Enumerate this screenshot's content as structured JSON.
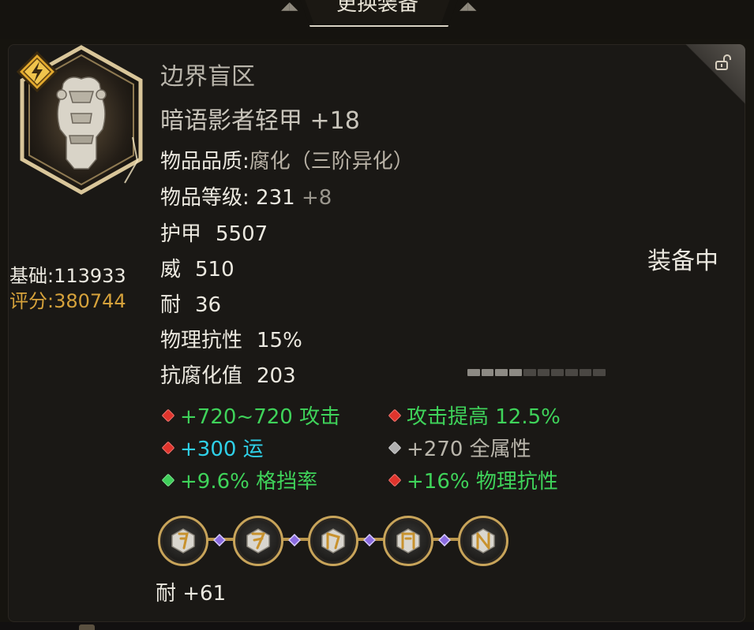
{
  "dialog": {
    "title": "更换装备"
  },
  "item": {
    "set_name": "边界盲区",
    "name": "暗语影者轻甲 +18",
    "quality_label": "物品品质:",
    "quality_value": "腐化（三阶异化）",
    "level_label": "物品等级:",
    "level_value": "231",
    "level_bonus": "+8",
    "base_stats": [
      {
        "label": "护甲",
        "value": "5507"
      },
      {
        "label": "威",
        "value": "510"
      },
      {
        "label": "耐",
        "value": "36"
      },
      {
        "label": "物理抗性",
        "value": "15%"
      },
      {
        "label": "抗腐化值",
        "value": "203"
      }
    ],
    "status": "装备中",
    "durability": {
      "filled": 4,
      "total": 10
    }
  },
  "score": {
    "base": "基础:113933",
    "rating": "评分:380744"
  },
  "affixes": [
    {
      "text": "+720~720 攻击",
      "color": "#3fd35a",
      "gem": "red"
    },
    {
      "text": "攻击提高 12.5%",
      "color": "#3fd35a",
      "gem": "red"
    },
    {
      "text": "+300 运",
      "color": "#2fd0e8",
      "gem": "red"
    },
    {
      "text": "+270 全属性",
      "color": "#b9b5ab",
      "gem": "gray"
    },
    {
      "text": "+9.6% 格挡率",
      "color": "#3fd35a",
      "gem": "green"
    },
    {
      "text": "+16% 物理抗性",
      "color": "#3fd35a",
      "gem": "red"
    }
  ],
  "sockets": {
    "count": 5,
    "icon": "rune-icon"
  },
  "socket_bonus": "耐 +61",
  "colors": {
    "accent_gold": "#d6a23b",
    "affix_green": "#3fd35a",
    "affix_cyan": "#2fd0e8",
    "gem_red": "#e0342c",
    "gem_green": "#3fcf5a",
    "gem_gray": "#b0b0b0"
  }
}
